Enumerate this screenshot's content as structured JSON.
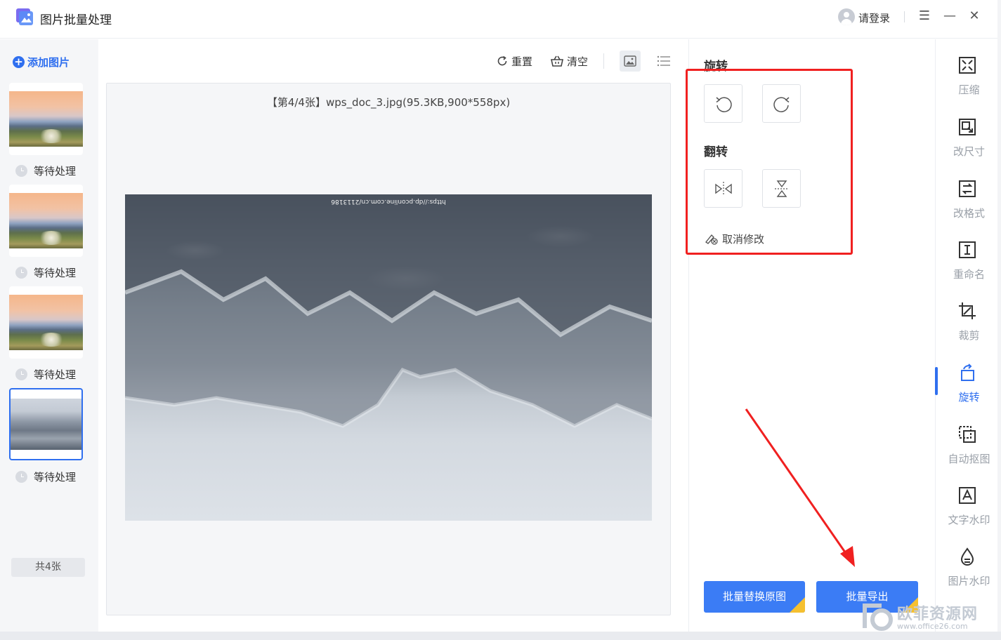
{
  "app": {
    "title": "图片批量处理",
    "login_label": "请登录"
  },
  "window_controls": {
    "menu": "☰",
    "minimize": "—",
    "close": "✕"
  },
  "left": {
    "add_label": "添加图片",
    "thumbnails": [
      {
        "status": "等待处理",
        "kind": "sunset"
      },
      {
        "status": "等待处理",
        "kind": "sunset"
      },
      {
        "status": "等待处理",
        "kind": "sunset"
      },
      {
        "status": "等待处理",
        "kind": "snowy",
        "selected": true
      }
    ],
    "count_label": "共4张"
  },
  "toolbar": {
    "reset_label": "重置",
    "clear_label": "清空",
    "view_image_icon": "image-view-icon",
    "view_list_icon": "list-view-icon"
  },
  "preview": {
    "caption": "【第4/4张】wps_doc_3.jpg(95.3KB,900*558px)",
    "watermark_url": "https://dp.pconline.com.cn/2113186"
  },
  "panel": {
    "rotate_title": "旋转",
    "flip_title": "翻转",
    "undo_label": "取消修改",
    "replace_label": "批量替换原图",
    "export_label": "批量导出"
  },
  "rail": {
    "items": [
      {
        "label": "压缩",
        "icon": "compress-icon"
      },
      {
        "label": "改尺寸",
        "icon": "resize-icon"
      },
      {
        "label": "改格式",
        "icon": "format-icon"
      },
      {
        "label": "重命名",
        "icon": "rename-icon"
      },
      {
        "label": "裁剪",
        "icon": "crop-icon"
      },
      {
        "label": "旋转",
        "icon": "rotate-icon",
        "active": true
      },
      {
        "label": "自动抠图",
        "icon": "cutout-icon"
      },
      {
        "label": "文字水印",
        "icon": "text-watermark-icon"
      },
      {
        "label": "图片水印",
        "icon": "image-watermark-icon"
      }
    ]
  },
  "site_watermark": {
    "name": "欧菲资源网",
    "url": "www.office26.com"
  },
  "colors": {
    "accent": "#2f6fef",
    "annotation_red": "#f02020",
    "button_blue": "#3b7cf5",
    "vip_gold": "#f5c030"
  }
}
